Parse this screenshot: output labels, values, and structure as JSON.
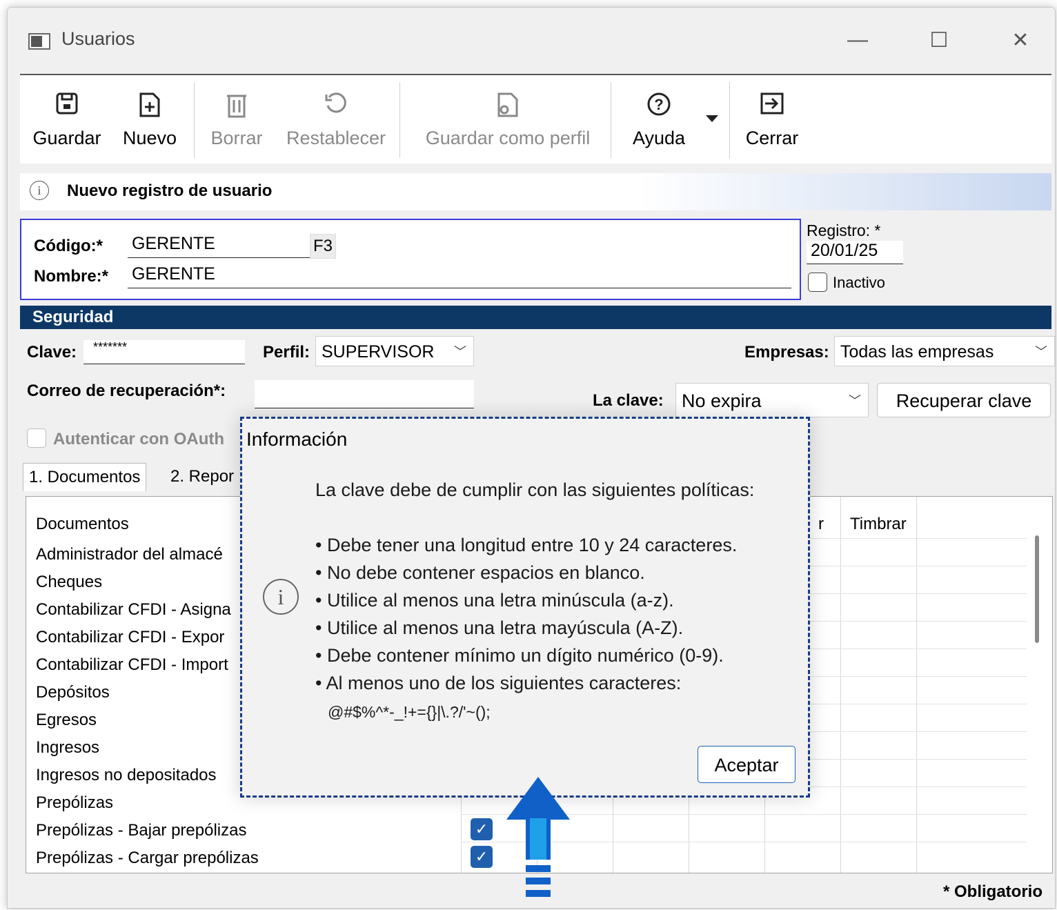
{
  "window": {
    "title": "Usuarios",
    "minimize": "—",
    "maximize": "☐",
    "close": "✕"
  },
  "toolbar": {
    "guardar": "Guardar",
    "nuevo": "Nuevo",
    "borrar": "Borrar",
    "restablecer": "Restablecer",
    "guardar_perfil": "Guardar como perfil",
    "ayuda": "Ayuda",
    "cerrar": "Cerrar"
  },
  "notice": {
    "text": "Nuevo registro de usuario"
  },
  "record": {
    "codigo_label": "Código:*",
    "codigo_value": "GERENTE",
    "f3": "F3",
    "nombre_label": "Nombre:*",
    "nombre_value": "GERENTE",
    "registro_label": "Registro: *",
    "registro_value": "20/01/25",
    "inactivo_label": "Inactivo"
  },
  "seguridad": {
    "header": "Seguridad",
    "clave_label": "Clave:",
    "clave_value": "*******",
    "perfil_label": "Perfil:",
    "perfil_value": "SUPERVISOR",
    "empresas_label": "Empresas:",
    "empresas_value": "Todas las empresas",
    "correo_label": "Correo de recuperación*:",
    "laclave_label": "La clave:",
    "laclave_value": "No expira",
    "recuperar_button": "Recuperar clave",
    "oauth_label": "Autenticar con OAuth"
  },
  "tabs": [
    "1. Documentos",
    "2. Repor"
  ],
  "grid": {
    "header": "Documentos",
    "header_r": "r",
    "timbrar": "Timbrar",
    "rows": [
      "Administrador del almacé",
      "Cheques",
      "Contabilizar CFDI - Asigna",
      "Contabilizar CFDI - Expor",
      "Contabilizar CFDI - Import",
      "Depósitos",
      "Egresos",
      "Ingresos",
      "Ingresos no depositados",
      "Prepólizas",
      "Prepólizas - Bajar prepólizas",
      "Prepólizas - Cargar prepólizas"
    ]
  },
  "dialog": {
    "title": "Información",
    "intro": "La clave debe de cumplir con las siguientes políticas:",
    "rules": [
      "• Debe tener una longitud entre 10 y 24 caracteres.",
      "• No debe contener espacios en blanco.",
      "• Utilice al menos una letra minúscula (a-z).",
      "• Utilice al menos una letra mayúscula (A-Z).",
      "• Debe contener mínimo un dígito numérico (0-9).",
      "• Al menos uno de los siguientes caracteres:"
    ],
    "chars": "@#$%^*-_!+={}|\\.?/'~();",
    "accept": "Aceptar"
  },
  "footer": {
    "obligatorio": "* Obligatorio"
  }
}
